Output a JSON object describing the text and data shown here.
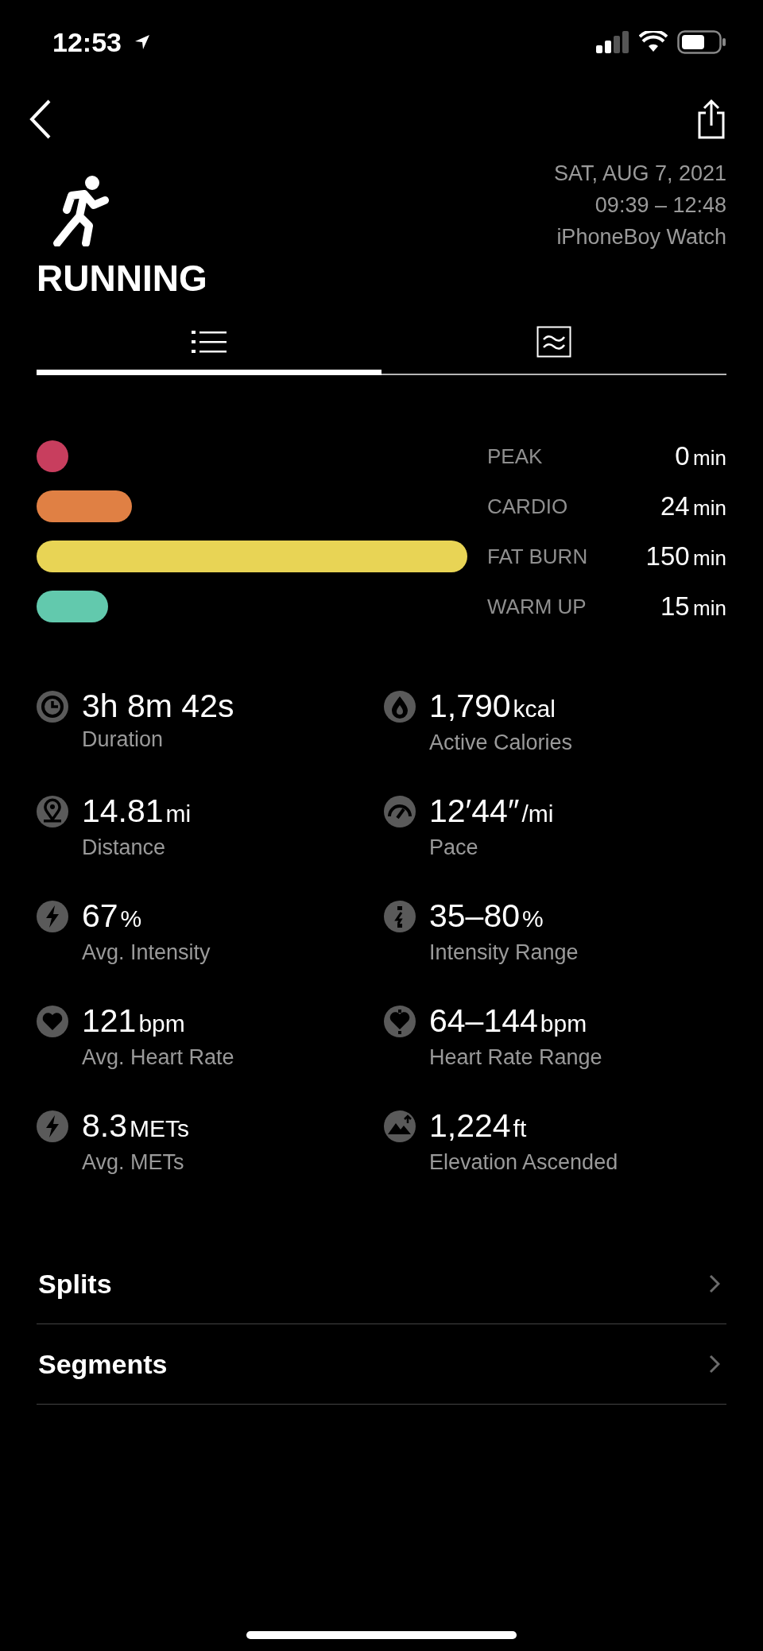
{
  "status_bar": {
    "time": "12:53"
  },
  "header": {
    "activity": "RUNNING",
    "date": "SAT, AUG 7, 2021",
    "time_range": "09:39 – 12:48",
    "device": "iPhoneBoy Watch"
  },
  "tabs": [
    {
      "selected": true
    },
    {
      "selected": false
    }
  ],
  "zones": [
    {
      "name": "PEAK",
      "value": "0",
      "unit": "min",
      "color": "#c83e5e"
    },
    {
      "name": "CARDIO",
      "value": "24",
      "unit": "min",
      "color": "#e08044"
    },
    {
      "name": "FAT BURN",
      "value": "150",
      "unit": "min",
      "color": "#e8d455"
    },
    {
      "name": "WARM UP",
      "value": "15",
      "unit": "min",
      "color": "#62c9ad"
    }
  ],
  "stats": [
    {
      "value": "3h 8m 42s",
      "label": "Duration"
    },
    {
      "value": "1,790",
      "unit": "kcal",
      "label": "Active Calories"
    },
    {
      "value": "14.81",
      "unit": "mi",
      "label": "Distance"
    },
    {
      "value": "12′44″",
      "unit": "/mi",
      "label": "Pace"
    },
    {
      "value": "67",
      "unit": "%",
      "label": "Avg. Intensity"
    },
    {
      "value": "35–80",
      "unit": "%",
      "label": "Intensity Range"
    },
    {
      "value": "121",
      "unit": "bpm",
      "label": "Avg. Heart Rate"
    },
    {
      "value": "64–144",
      "unit": "bpm",
      "label": "Heart Rate Range"
    },
    {
      "value": "8.3",
      "unit": "METs",
      "label": "Avg. METs"
    },
    {
      "value": "1,224",
      "unit": "ft",
      "label": "Elevation Ascended"
    }
  ],
  "links": [
    "Splits",
    "Segments"
  ]
}
